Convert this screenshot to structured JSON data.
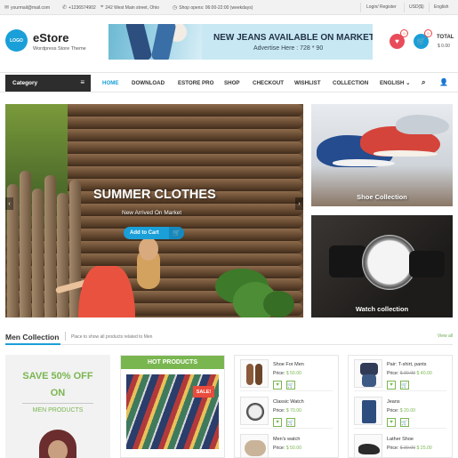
{
  "topbar": {
    "email": "yourmail@mail.com",
    "phone": "+1236574902",
    "address": "242 West Main street, Ohio",
    "hours": "Shop opens: 06:00-22:00 (weekdays)",
    "login": "Login/ Register",
    "currency": "USD($)",
    "language": "English"
  },
  "header": {
    "logo_text": "LOGO",
    "brand": "eStore",
    "tagline": "Wordpress Store Theme",
    "banner_title": "NEW JEANS AVAILABLE ON MARKET",
    "banner_sub": "Advertise Here : 728 * 90",
    "wishlist_count": "0",
    "cart_count": "0",
    "total_label": "TOTAL",
    "total_value": "$ 0.00"
  },
  "nav": {
    "category": "Category",
    "items": [
      "HOME",
      "DOWNLOAD",
      "ESTORE PRO",
      "SHOP",
      "CHECKOUT",
      "WISHLIST",
      "COLLECTION",
      "ENGLISH"
    ]
  },
  "slider": {
    "title": "SUMMER CLOTHES",
    "subtitle": "New Arrived On Market",
    "button": "Add to Cart"
  },
  "side": {
    "shoe": "Shoe Collection",
    "watch": "Watch collection"
  },
  "section": {
    "title": "Men Collection",
    "desc": "Place to show all products related to Men",
    "view_all": "View all"
  },
  "promo": {
    "line1": "SAVE 50% OFF",
    "line2": "ON",
    "line3": "MEN PRODUCTS"
  },
  "hot": {
    "title": "HOT PRODUCTS",
    "sale": "SALE!"
  },
  "list1": [
    {
      "name": "Shoe For Men",
      "price_label": "Price:",
      "price": "$ 50.00",
      "old": ""
    },
    {
      "name": "Classic Watch",
      "price_label": "Price:",
      "price": "$ 70.00",
      "old": ""
    },
    {
      "name": "Men's watch",
      "price_label": "Price:",
      "price": "$ 50.00",
      "old": ""
    }
  ],
  "list2": [
    {
      "name": "Pair: T-shirt, pants",
      "price_label": "Price:",
      "price": "$ 40.00",
      "old": "$ 30.00"
    },
    {
      "name": "Jeans",
      "price_label": "Price:",
      "price": "$ 20.00",
      "old": ""
    },
    {
      "name": "Lather Shoe",
      "price_label": "Price:",
      "price": "$ 25.00",
      "old": "$ 30.00"
    }
  ],
  "colors": {
    "accent": "#1a9fd8",
    "green": "#7ab650",
    "dark": "#2d2d2d",
    "red": "#e94b3c"
  }
}
